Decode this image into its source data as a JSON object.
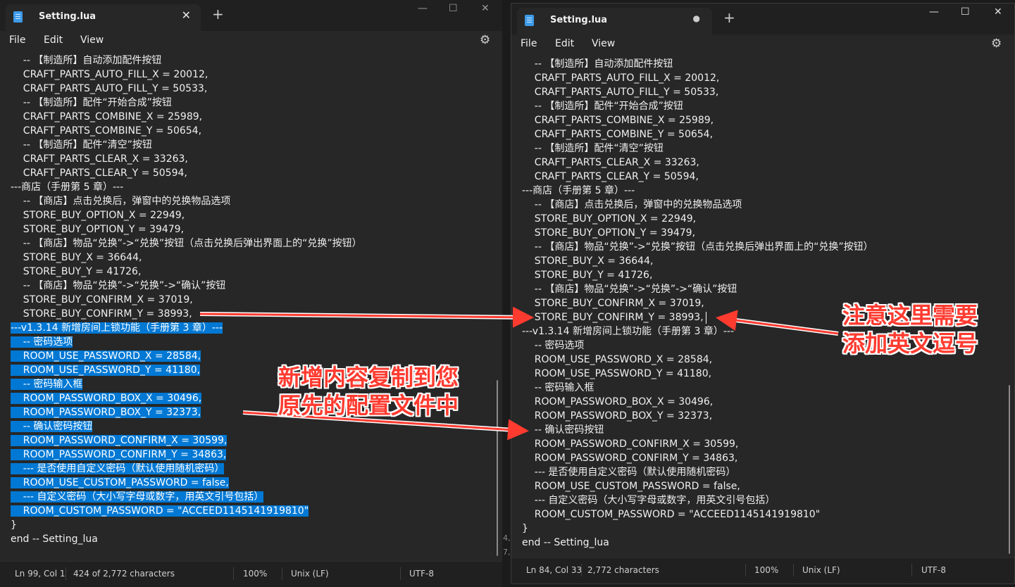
{
  "left_window": {
    "tab_title": "Setting.lua",
    "menu": [
      "File",
      "Edit",
      "View"
    ],
    "status": {
      "position": "Ln 99, Col 1",
      "chars": "424 of 2,772 characters",
      "zoom": "100%",
      "eol": "Unix (LF)",
      "encoding": "UTF-8"
    },
    "lines": [
      {
        "text": "    -- 【制造所】自动添加配件按钮",
        "sel": false
      },
      {
        "text": "    CRAFT_PARTS_AUTO_FILL_X = 20012,",
        "sel": false
      },
      {
        "text": "    CRAFT_PARTS_AUTO_FILL_Y = 50533,",
        "sel": false
      },
      {
        "text": "    -- 【制造所】配件“开始合成”按钮",
        "sel": false
      },
      {
        "text": "    CRAFT_PARTS_COMBINE_X = 25989,",
        "sel": false
      },
      {
        "text": "    CRAFT_PARTS_COMBINE_Y = 50654,",
        "sel": false
      },
      {
        "text": "    -- 【制造所】配件“清空”按钮",
        "sel": false
      },
      {
        "text": "    CRAFT_PARTS_CLEAR_X = 33263,",
        "sel": false
      },
      {
        "text": "    CRAFT_PARTS_CLEAR_Y = 50594,",
        "sel": false
      },
      {
        "text": "---商店（手册第 5 章）---",
        "sel": false
      },
      {
        "text": "    -- 【商店】点击兑换后，弹窗中的兑换物品选项",
        "sel": false
      },
      {
        "text": "    STORE_BUY_OPTION_X = 22949,",
        "sel": false
      },
      {
        "text": "    STORE_BUY_OPTION_Y = 39479,",
        "sel": false
      },
      {
        "text": "    -- 【商店】物品“兑换”->“兑换”按钮（点击兑换后弹出界面上的“兑换”按钮）",
        "sel": false
      },
      {
        "text": "    STORE_BUY_X = 36644,",
        "sel": false
      },
      {
        "text": "    STORE_BUY_Y = 41726,",
        "sel": false
      },
      {
        "text": "    -- 【商店】物品“兑换”->“兑换”->“确认”按钮",
        "sel": false
      },
      {
        "text": "    STORE_BUY_CONFIRM_X = 37019,",
        "sel": false
      },
      {
        "text": "    STORE_BUY_CONFIRM_Y = 38993,",
        "sel": false
      },
      {
        "text": "---v1.3.14 新增房间上锁功能（手册第 3 章）---",
        "sel": true
      },
      {
        "text": "    -- 密码选项",
        "sel": true
      },
      {
        "text": "    ROOM_USE_PASSWORD_X = 28584,",
        "sel": true
      },
      {
        "text": "    ROOM_USE_PASSWORD_Y = 41180,",
        "sel": true
      },
      {
        "text": "    -- 密码输入框",
        "sel": true
      },
      {
        "text": "    ROOM_PASSWORD_BOX_X = 30496,",
        "sel": true
      },
      {
        "text": "    ROOM_PASSWORD_BOX_Y = 32373,",
        "sel": true
      },
      {
        "text": "    -- 确认密码按钮",
        "sel": true
      },
      {
        "text": "    ROOM_PASSWORD_CONFIRM_X = 30599,",
        "sel": true
      },
      {
        "text": "    ROOM_PASSWORD_CONFIRM_Y = 34863,",
        "sel": true
      },
      {
        "text": "    --- 是否使用自定义密码（默认使用随机密码）",
        "sel": true
      },
      {
        "text": "    ROOM_USE_CUSTOM_PASSWORD = false,",
        "sel": true
      },
      {
        "text": "    --- 自定义密码（大小写字母或数字，用英文引号包括）",
        "sel": true
      },
      {
        "text": "    ROOM_CUSTOM_PASSWORD = \"ACCEED1145141919810\"",
        "sel": true
      },
      {
        "text": "}",
        "sel": false
      },
      {
        "text": "end -- Setting_lua",
        "sel": false
      }
    ]
  },
  "right_window": {
    "tab_title": "Setting.lua",
    "menu": [
      "File",
      "Edit",
      "View"
    ],
    "status": {
      "position": "Ln 84, Col 33",
      "chars": "2,772 characters",
      "zoom": "100%",
      "eol": "Unix (LF)",
      "encoding": "UTF-8"
    },
    "lines": [
      "    -- 【制造所】自动添加配件按钮",
      "    CRAFT_PARTS_AUTO_FILL_X = 20012,",
      "    CRAFT_PARTS_AUTO_FILL_Y = 50533,",
      "    -- 【制造所】配件“开始合成”按钮",
      "    CRAFT_PARTS_COMBINE_X = 25989,",
      "    CRAFT_PARTS_COMBINE_Y = 50654,",
      "    -- 【制造所】配件“清空”按钮",
      "    CRAFT_PARTS_CLEAR_X = 33263,",
      "    CRAFT_PARTS_CLEAR_Y = 50594,",
      "---商店（手册第 5 章）---",
      "    -- 【商店】点击兑换后，弹窗中的兑换物品选项",
      "    STORE_BUY_OPTION_X = 22949,",
      "    STORE_BUY_OPTION_Y = 39479,",
      "    -- 【商店】物品“兑换”->“兑换”按钮（点击兑换后弹出界面上的“兑换”按钮）",
      "    STORE_BUY_X = 36644,",
      "    STORE_BUY_Y = 41726,",
      "    -- 【商店】物品“兑换”->“兑换”->“确认”按钮",
      "    STORE_BUY_CONFIRM_X = 37019,",
      "    STORE_BUY_CONFIRM_Y = 38993,",
      "---v1.3.14 新增房间上锁功能（手册第 3 章）---",
      "    -- 密码选项",
      "    ROOM_USE_PASSWORD_X = 28584,",
      "    ROOM_USE_PASSWORD_Y = 41180,",
      "    -- 密码输入框",
      "    ROOM_PASSWORD_BOX_X = 30496,",
      "    ROOM_PASSWORD_BOX_Y = 32373,",
      "    -- 确认密码按钮",
      "    ROOM_PASSWORD_CONFIRM_X = 30599,",
      "    ROOM_PASSWORD_CONFIRM_Y = 34863,",
      "    --- 是否使用自定义密码（默认使用随机密码）",
      "    ROOM_USE_CUSTOM_PASSWORD = false,",
      "    --- 自定义密码（大小写字母或数字，用英文引号包括）",
      "    ROOM_CUSTOM_PASSWORD = \"ACCEED1145141919810\"",
      "}",
      "end -- Setting_lua"
    ]
  },
  "annotations": {
    "copy_note": "新增内容复制到您\n原先的配置文件中",
    "comma_note": "注意这里需要\n添加英文逗号"
  },
  "background_fragments": [
    "4,",
    "7,"
  ],
  "colors": {
    "selection": "#0078d4",
    "annotation": "#ff3b30",
    "editor_bg": "#272727",
    "titlebar_bg": "#202020"
  }
}
